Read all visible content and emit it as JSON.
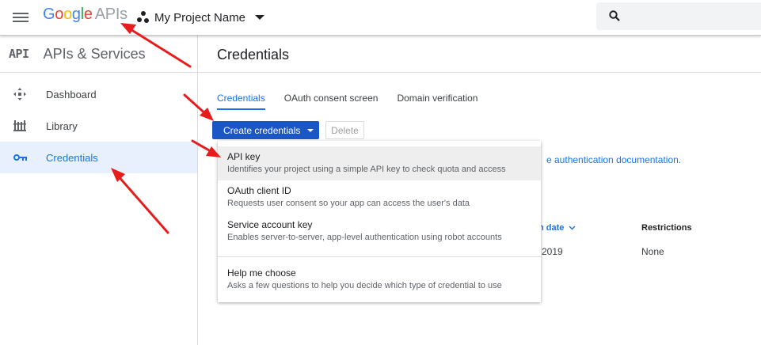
{
  "topbar": {
    "logo_text": "Google",
    "logo_suffix": "APIs",
    "project_name": "My Project Name"
  },
  "sidebar": {
    "badge": "API",
    "title": "APIs & Services",
    "items": [
      {
        "label": "Dashboard",
        "icon": "dashboard-icon"
      },
      {
        "label": "Library",
        "icon": "library-icon"
      },
      {
        "label": "Credentials",
        "icon": "key-icon",
        "active": true
      }
    ]
  },
  "main": {
    "title": "Credentials",
    "tabs": [
      {
        "label": "Credentials",
        "active": true
      },
      {
        "label": "OAuth consent screen"
      },
      {
        "label": "Domain verification"
      }
    ],
    "create_button": "Create credentials",
    "delete_button": "Delete",
    "info_link_fragment": "e authentication documentation.",
    "table": {
      "date_header_fragment": "n date",
      "restrictions_header": "Restrictions",
      "row_date_fragment": "2019",
      "row_restrictions": "None"
    }
  },
  "menu": {
    "items": [
      {
        "label": "API key",
        "description": "Identifies your project using a simple API key to check quota and access"
      },
      {
        "label": "OAuth client ID",
        "description": "Requests user consent so your app can access the user's data"
      },
      {
        "label": "Service account key",
        "description": "Enables server-to-server, app-level authentication using robot accounts"
      },
      {
        "label": "Help me choose",
        "description": "Asks a few questions to help you decide which type of credential to use"
      }
    ]
  },
  "colors": {
    "accent": "#1a73e8",
    "primary_button": "#1a56c4",
    "annotation_arrow": "#e81c1c",
    "active_nav_bg": "#e8f0fe"
  }
}
